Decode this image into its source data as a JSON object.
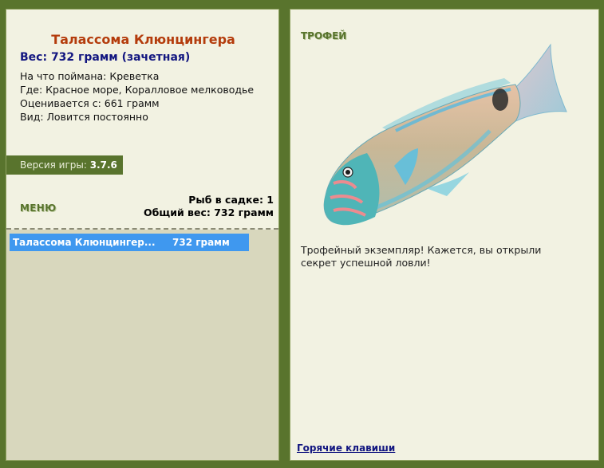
{
  "fish": {
    "title": "Талассома Клюнцингера",
    "weight_line": "Вес: 732 грамм (зачетная)",
    "caught_on": "На что поймана: Креветка",
    "where": "Где: Красное море, Коралловое мелководье",
    "rated_from": "Оценивается с: 661 грамм",
    "kind": "Вид: Ловится постоянно"
  },
  "version": {
    "label": "Версия игры:",
    "value": "3.7.6"
  },
  "menu": {
    "label": "МЕНЮ"
  },
  "keepnet": {
    "count_line": "Рыб в садке: 1",
    "total_line": "Общий вес: 732 грамм",
    "items": [
      {
        "name": "Талассома Клюнцингер...",
        "weight": "732 грамм"
      }
    ]
  },
  "trophy": {
    "label": "ТРОФЕЙ",
    "message": "Трофейный экземпляр! Кажется, вы открыли секрет успешной ловли!"
  },
  "hotkeys": {
    "label": "Горячие клавиши"
  },
  "colors": {
    "background": "#59742d",
    "panel": "#f2f2e2",
    "title": "#b43c0c",
    "weight": "#121680",
    "selection": "#3f98ef",
    "list_bg": "#d8d7bd"
  }
}
